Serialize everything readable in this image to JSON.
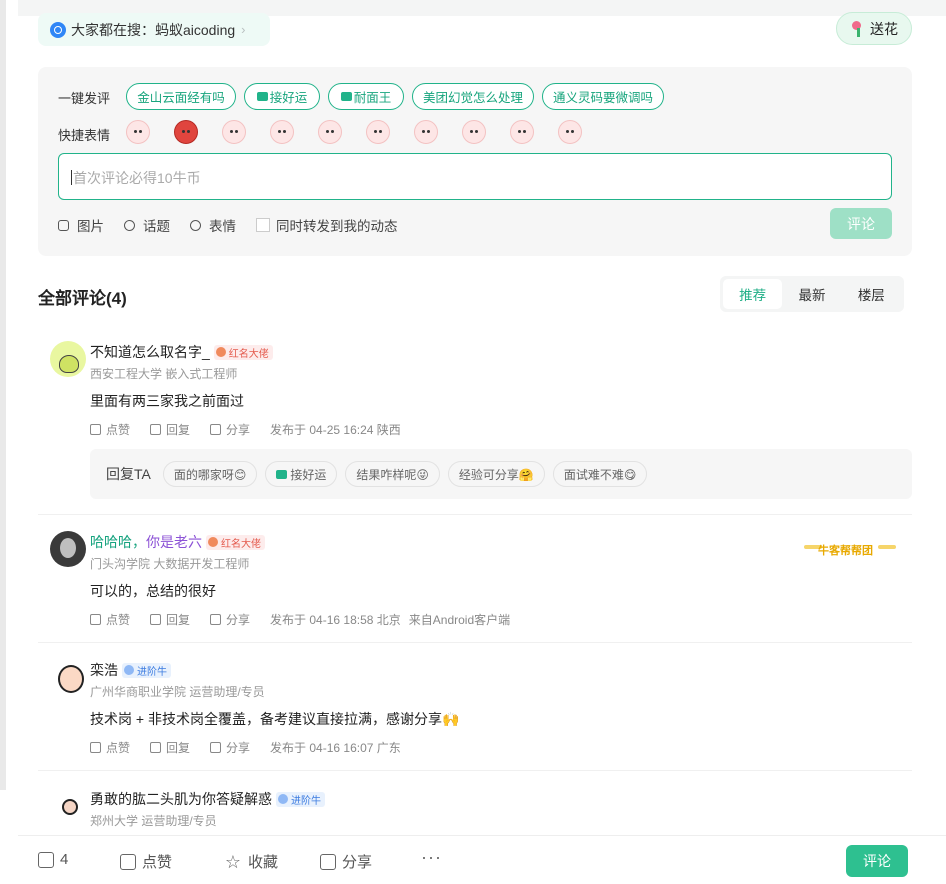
{
  "search": {
    "prefix": "大家都在搜：",
    "term": "蚂蚁aicoding"
  },
  "flower_button": "送花",
  "comment_box": {
    "quick_comment_label": "一键发评",
    "quick_comments": [
      "金山云面经有吗",
      "接好运",
      "耐面王",
      "美团幻觉怎么处理",
      "通义灵码要微调吗"
    ],
    "emoji_label": "快捷表情",
    "placeholder": "首次评论必得10牛币",
    "tools": {
      "image": "图片",
      "topic": "话题",
      "emoji": "表情"
    },
    "repost_label": "同时转发到我的动态",
    "submit": "评论"
  },
  "comments_header": {
    "title": "全部评论(4)",
    "tabs": [
      "推荐",
      "最新",
      "楼层"
    ],
    "active_tab": "推荐"
  },
  "comments": [
    {
      "name": "不知道怎么取名字_",
      "badge": "红名大佬",
      "subtitle": "西安工程大学 嵌入式工程师",
      "text": "里面有两三家我之前面过",
      "like": "点赞",
      "reply": "回复",
      "share": "分享",
      "meta": "发布于 04-25 16:24 陕西",
      "reply_prompt": {
        "label": "回复TA",
        "chips": [
          "面的哪家呀😊",
          "接好运",
          "结果咋样呢😜",
          "经验可分享🤗",
          "面试难不难😋"
        ]
      }
    },
    {
      "name_part1": "哈哈哈，",
      "name_part2": "你是老六",
      "badge": "红名大佬",
      "subtitle": "门头沟学院 大数据开发工程师",
      "text": "可以的，总结的很好",
      "like": "点赞",
      "reply": "回复",
      "share": "分享",
      "meta": "发布于 04-16 18:58 北京",
      "client": "来自Android客户端",
      "pendant": "牛客帮帮团"
    },
    {
      "name": "栾浩",
      "badge": "进阶牛",
      "subtitle": "广州华商职业学院 运营助理/专员",
      "text": "技术岗 + 非技术岗全覆盖，备考建议直接拉满，感谢分享🙌",
      "like": "点赞",
      "reply": "回复",
      "share": "分享",
      "meta": "发布于 04-16 16:07 广东"
    },
    {
      "name": "勇敢的肱二头肌为你答疑解惑",
      "badge": "进阶牛",
      "subtitle": "郑州大学 运营助理/专员"
    }
  ],
  "bottom_bar": {
    "comment_count": "4",
    "like": "点赞",
    "collect": "收藏",
    "share": "分享",
    "more": "···",
    "comment_button": "评论"
  },
  "colors": {
    "accent": "#2ec090",
    "accent_text": "#1fae86",
    "badge_red": "#e45a4d",
    "badge_blue": "#3b7be0"
  }
}
